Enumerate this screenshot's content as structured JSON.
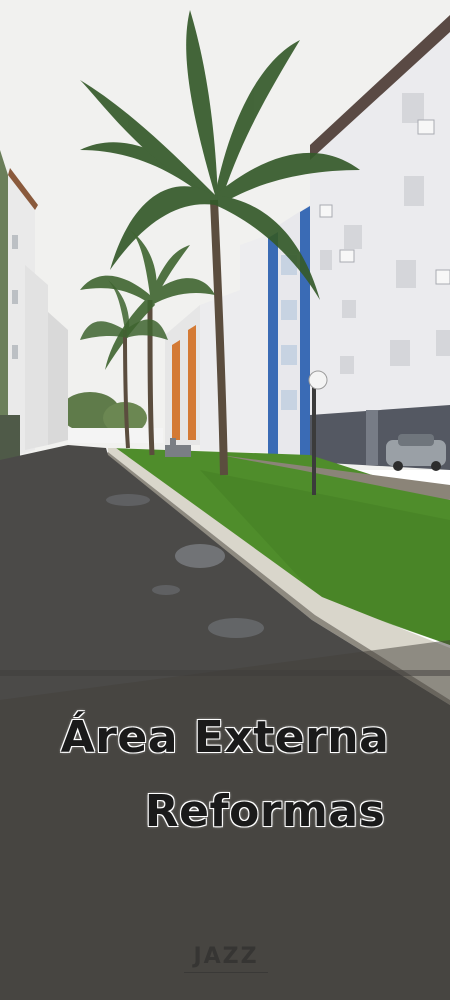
{
  "photo": {
    "subject": "apartment-complex-exterior",
    "caption_line1": "Área Externa",
    "caption_line2": "Reformas",
    "watermark": "JAZZ"
  },
  "colors": {
    "sky": "#f2f2f0",
    "building": "#e9e9ec",
    "building_shadow": "#c9cbd2",
    "accent_blue": "#3a6bb5",
    "grass": "#4e8c2a",
    "pavement": "#4a4a4a",
    "curb": "#d8d6cc"
  }
}
